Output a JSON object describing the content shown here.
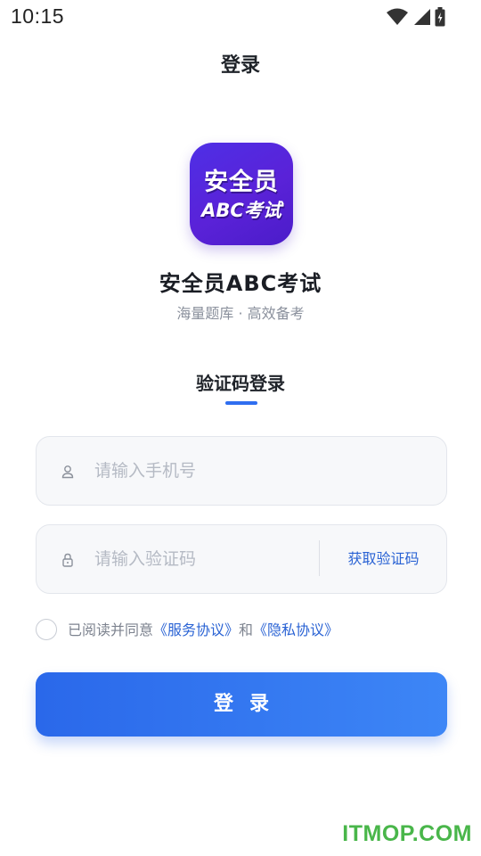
{
  "status_bar": {
    "time": "10:15",
    "icons": [
      "wifi-icon",
      "signal-icon",
      "battery-icon"
    ]
  },
  "header": {
    "title": "登录"
  },
  "app": {
    "logo_line1": "安全员",
    "logo_line2": "ABC考试",
    "name": "安全员ABC考试",
    "slogan": "海量题库 · 高效备考"
  },
  "tab": {
    "label": "验证码登录"
  },
  "form": {
    "phone": {
      "placeholder": "请输入手机号",
      "value": "",
      "icon": "user-icon"
    },
    "code": {
      "placeholder": "请输入验证码",
      "value": "",
      "icon": "lock-icon"
    },
    "get_code_label": "获取验证码"
  },
  "agreement": {
    "checked": false,
    "prefix": "已阅读并同意",
    "service_link": "《服务协议》",
    "and": "和",
    "privacy_link": "《隐私协议》"
  },
  "login_button": {
    "label": "登录"
  },
  "watermark": {
    "text": "ITMOP.COM"
  },
  "colors": {
    "accent": "#2f6ef0",
    "logo_bg": "#5228dd",
    "watermark": "#49b64a"
  }
}
